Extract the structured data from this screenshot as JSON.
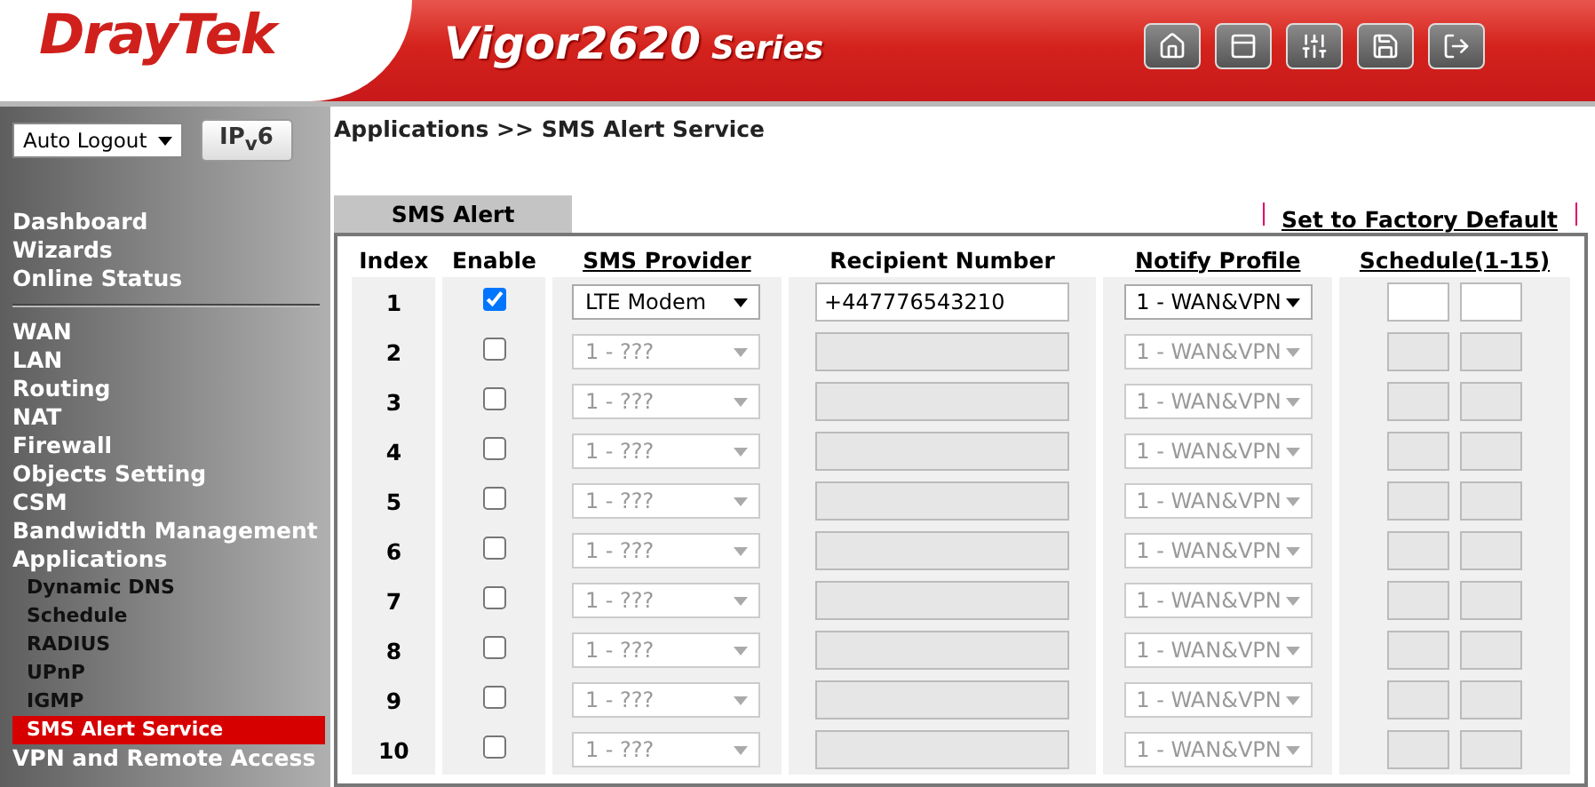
{
  "header": {
    "brand": "DrayTek",
    "model": "Vigor2620",
    "series": "Series"
  },
  "sidebar": {
    "logout_select": "Auto Logout",
    "ipv6_button": "IP$_{v}$6",
    "groups": [
      [
        {
          "label": "Dashboard",
          "selected": false
        },
        {
          "label": "Wizards",
          "selected": false
        },
        {
          "label": "Online Status",
          "selected": false
        }
      ],
      [
        {
          "label": "WAN",
          "selected": false
        },
        {
          "label": "LAN",
          "selected": false
        },
        {
          "label": "Routing",
          "selected": false
        },
        {
          "label": "NAT",
          "selected": false
        },
        {
          "label": "Firewall",
          "selected": false
        },
        {
          "label": "Objects Setting",
          "selected": false
        },
        {
          "label": "CSM",
          "selected": false
        },
        {
          "label": "Bandwidth Management",
          "selected": false
        },
        {
          "label": "Applications",
          "selected": false,
          "children": [
            {
              "label": "Dynamic DNS",
              "selected": false
            },
            {
              "label": "Schedule",
              "selected": false
            },
            {
              "label": "RADIUS",
              "selected": false
            },
            {
              "label": "UPnP",
              "selected": false
            },
            {
              "label": "IGMP",
              "selected": false
            },
            {
              "label": "SMS Alert Service",
              "selected": true
            }
          ]
        },
        {
          "label": "VPN and Remote Access",
          "selected": false
        }
      ]
    ]
  },
  "breadcrumb": "Applications >> SMS Alert Service",
  "tab": "SMS Alert",
  "factory_default_link": "Set to Factory Default",
  "table": {
    "columns": [
      "Index",
      "Enable",
      "SMS Provider",
      "Recipient Number",
      "Notify Profile",
      "Schedule(1-15)"
    ],
    "rows": [
      {
        "index": "1",
        "checked": true,
        "provider": "LTE Modem",
        "recipient": "+447776543210",
        "profile": "1 - WAN&VPN"
      },
      {
        "index": "2",
        "checked": false,
        "provider": "1 - ???",
        "profile": "1 - WAN&VPN"
      },
      {
        "index": "3",
        "checked": false,
        "provider": "1 - ???",
        "profile": "1 - WAN&VPN"
      },
      {
        "index": "4",
        "checked": false,
        "provider": "1 - ???",
        "profile": "1 - WAN&VPN"
      },
      {
        "index": "5",
        "checked": false,
        "provider": "1 - ???",
        "profile": "1 - WAN&VPN"
      },
      {
        "index": "6",
        "checked": false,
        "provider": "1 - ???",
        "profile": "1 - WAN&VPN"
      },
      {
        "index": "7",
        "checked": false,
        "provider": "1 - ???",
        "profile": "1 - WAN&VPN"
      },
      {
        "index": "8",
        "checked": false,
        "provider": "1 - ???",
        "profile": "1 - WAN&VPN"
      },
      {
        "index": "9",
        "checked": false,
        "provider": "1 - ???",
        "profile": "1 - WAN&VPN"
      },
      {
        "index": "10",
        "checked": false,
        "provider": "1 - ???",
        "profile": "1 - WAN&VPN"
      }
    ]
  }
}
